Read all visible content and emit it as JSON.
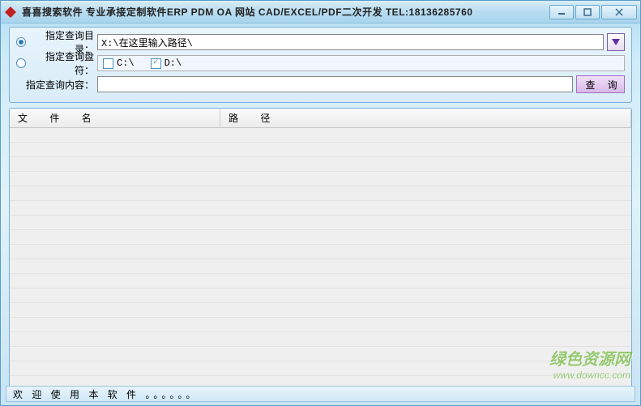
{
  "titlebar": {
    "title": "喜喜搜索软件    专业承接定制软件ERP PDM OA 网站 CAD/EXCEL/PDF二次开发 TEL:18136285760"
  },
  "search": {
    "dir_label": "指定查询目录：",
    "dir_value": "X:\\在这里输入路径\\",
    "drive_label": "指定查询盘符：",
    "drive_c": "C:\\",
    "drive_d": "D:\\",
    "drive_c_checked": false,
    "drive_d_checked": true,
    "content_label": "指定查询内容：",
    "content_value": "",
    "search_btn": "查 询"
  },
  "table": {
    "col_filename": "文 件 名",
    "col_path": "路  径",
    "rows": []
  },
  "status": {
    "text": "欢 迎 使 用 本 软 件 。。。。。。"
  },
  "watermark": {
    "line1": "绿色资源网",
    "line2": "www.downcc.com"
  }
}
